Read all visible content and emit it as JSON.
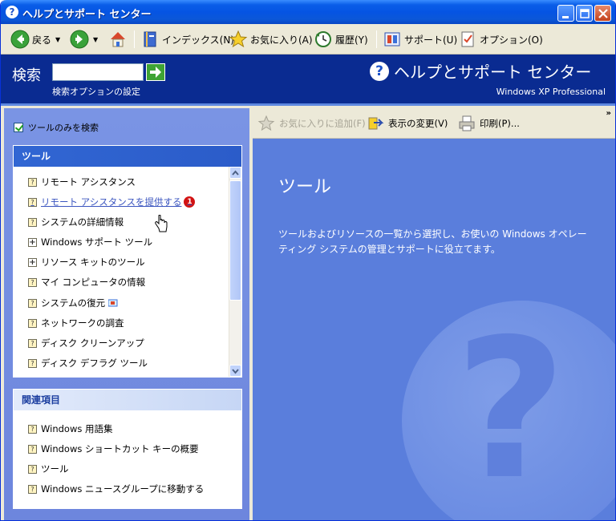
{
  "window": {
    "title": "ヘルプとサポート センター"
  },
  "toolbar": {
    "back_label": "戻る",
    "index_label": "インデックス(N)",
    "favorites_label": "お気に入り(A)",
    "history_label": "履歴(Y)",
    "support_label": "サポート(U)",
    "options_label": "オプション(O)"
  },
  "search": {
    "label": "検索",
    "value": "",
    "options_link": "検索オプションの設定"
  },
  "header": {
    "title": "ヘルプとサポート センター",
    "subtitle": "Windows XP Professional"
  },
  "filter": {
    "checkbox_label": "ツールのみを検索",
    "checked": true
  },
  "tools_panel": {
    "title": "ツール",
    "items": [
      {
        "label": "リモート アシスタンス",
        "icon": "help-page-icon"
      },
      {
        "label": "リモート アシスタンスを提供する",
        "icon": "help-page-icon",
        "badge": "1"
      },
      {
        "label": "システムの詳細情報",
        "icon": "help-page-icon"
      },
      {
        "label": "Windows サポート ツール",
        "icon": "expand-plus-icon"
      },
      {
        "label": "リソース キットのツール",
        "icon": "expand-plus-icon"
      },
      {
        "label": "マイ コンピュータの情報",
        "icon": "help-page-icon"
      },
      {
        "label": "システムの復元",
        "icon": "help-page-icon"
      },
      {
        "label": "ネットワークの調査",
        "icon": "help-page-icon"
      },
      {
        "label": "ディスク クリーンアップ",
        "icon": "help-page-icon"
      },
      {
        "label": "ディスク デフラグ ツール",
        "icon": "help-page-icon"
      }
    ]
  },
  "related_panel": {
    "title": "関連項目",
    "items": [
      {
        "label": "Windows 用語集"
      },
      {
        "label": "Windows ショートカット キーの概要"
      },
      {
        "label": "ツール"
      },
      {
        "label": "Windows ニュースグループに移動する"
      }
    ]
  },
  "content_toolbar": {
    "add_favorites_label": "お気に入りに追加(F)",
    "change_view_label": "表示の変更(V)",
    "print_label": "印刷(P)...",
    "more_label": "»"
  },
  "content": {
    "title": "ツール",
    "description": "ツールおよびリソースの一覧から選択し、お使いの Windows オペレーティング システムの管理とサポートに役立てます。"
  },
  "colors": {
    "titlebar": "#0554e3",
    "search_band": "#0a2b91",
    "content_bg": "#5a7edc",
    "left_pane": "#7a94e4",
    "link": "#3b55bf",
    "badge": "#d21212"
  }
}
